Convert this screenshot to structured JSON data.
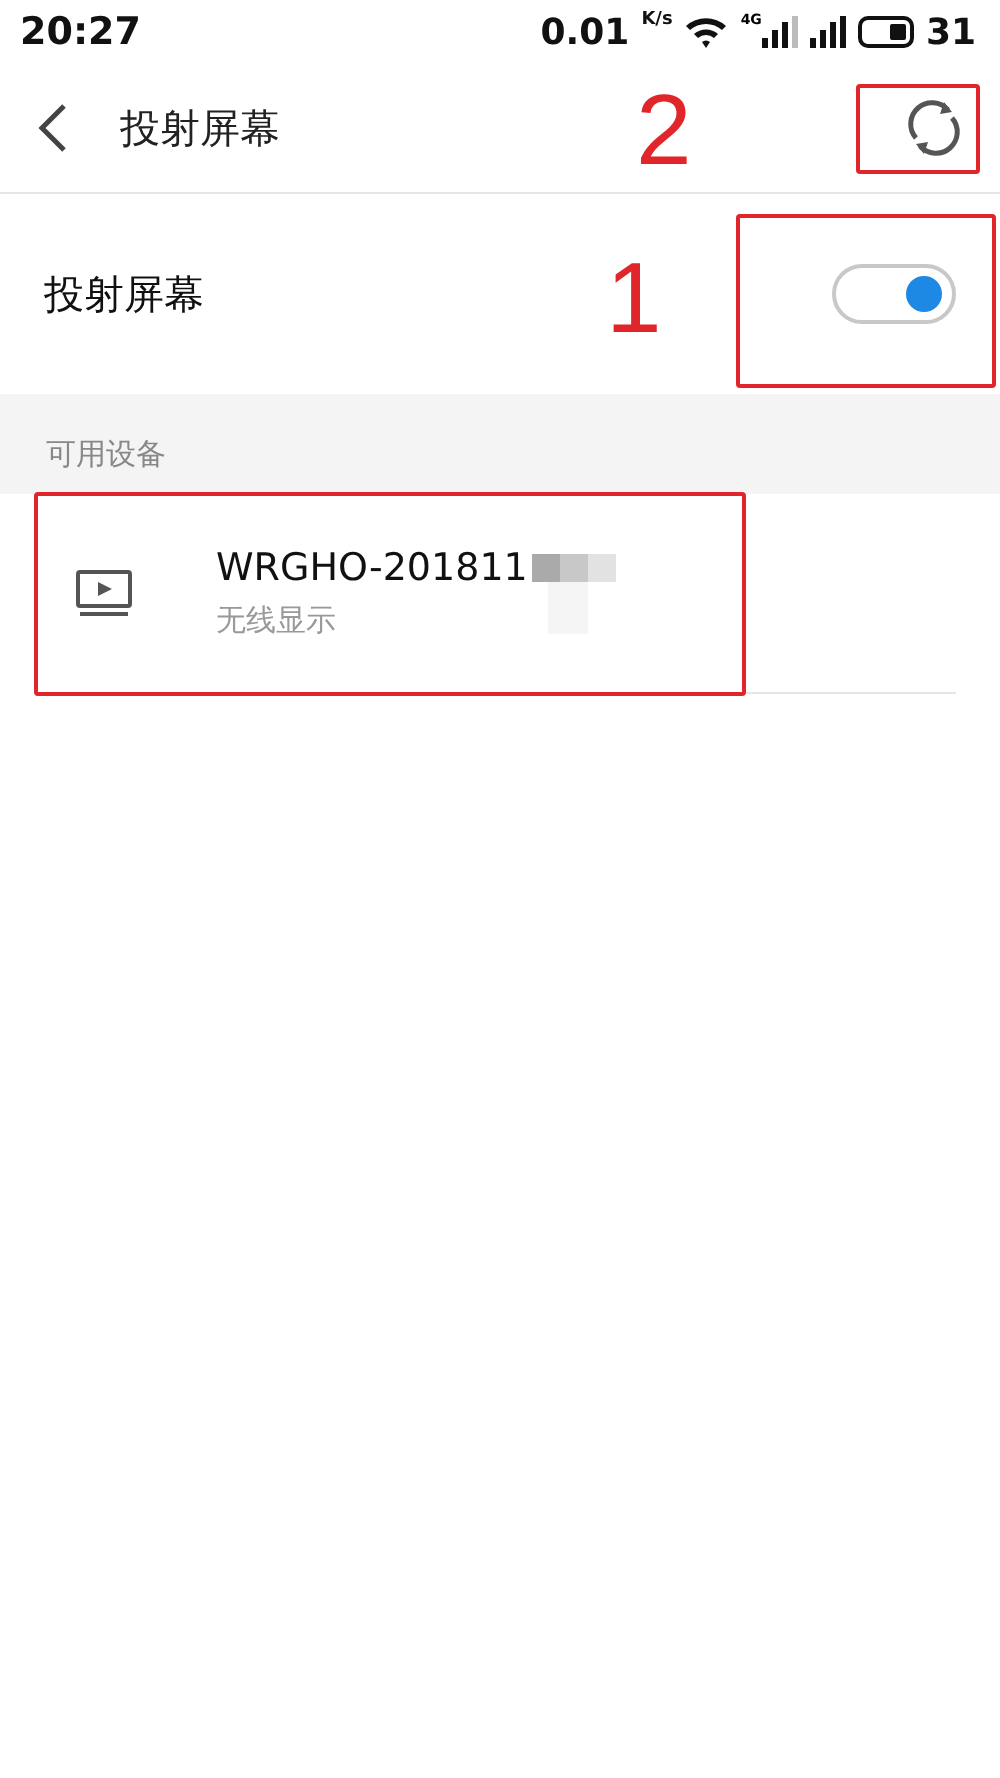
{
  "status_bar": {
    "time": "20:27",
    "speed": "0.01",
    "speed_unit": "K/s",
    "network": "4G",
    "battery": "31"
  },
  "header": {
    "title": "投射屏幕"
  },
  "cast_toggle": {
    "label": "投射屏幕",
    "on": true
  },
  "section": {
    "title": "可用设备"
  },
  "devices": [
    {
      "name": "WRGHO-201811",
      "subtitle": "无线显示"
    }
  ],
  "annotations": [
    {
      "number": "2"
    },
    {
      "number": "1"
    }
  ]
}
